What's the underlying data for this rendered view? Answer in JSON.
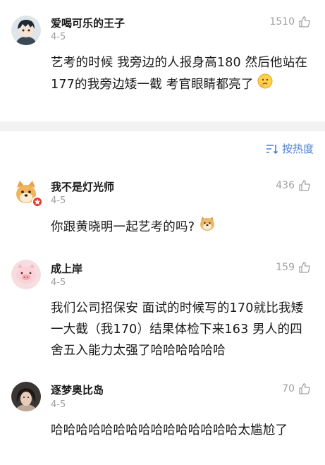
{
  "sort": {
    "label": "按热度",
    "icon": "sort-icon",
    "accent": "#4a7fd4"
  },
  "comments": [
    {
      "username": "爱喝可乐的王子",
      "date": "4-5",
      "likes": "1510",
      "text": "艺考的时候 我旁边的人报身高180 然后他站在177的我旁边矮一截 考官眼睛都亮了",
      "emoji": "thinking-face-emoji",
      "avatar": "anime-boy-avatar"
    },
    {
      "username": "我不是灯光师",
      "date": "4-5",
      "likes": "436",
      "text": "你跟黄晓明一起艺考的吗?",
      "emoji": "doge-emoji",
      "avatar": "shiba-dog-avatar",
      "badge": "verified-badge"
    },
    {
      "username": "成上岸",
      "date": "4-5",
      "likes": "159",
      "text": "我们公司招保安 面试的时候写的170就比我矮一大截（我170）结果体检下来163 男人的四舍五入能力太强了哈哈哈哈哈哈",
      "avatar": "pink-pig-avatar"
    },
    {
      "username": "逐梦奥比岛",
      "date": "4-5",
      "likes": "70",
      "text": "哈哈哈哈哈哈哈哈哈哈哈哈哈哈哈太尴尬了",
      "avatar": "girl-photo-avatar"
    }
  ]
}
